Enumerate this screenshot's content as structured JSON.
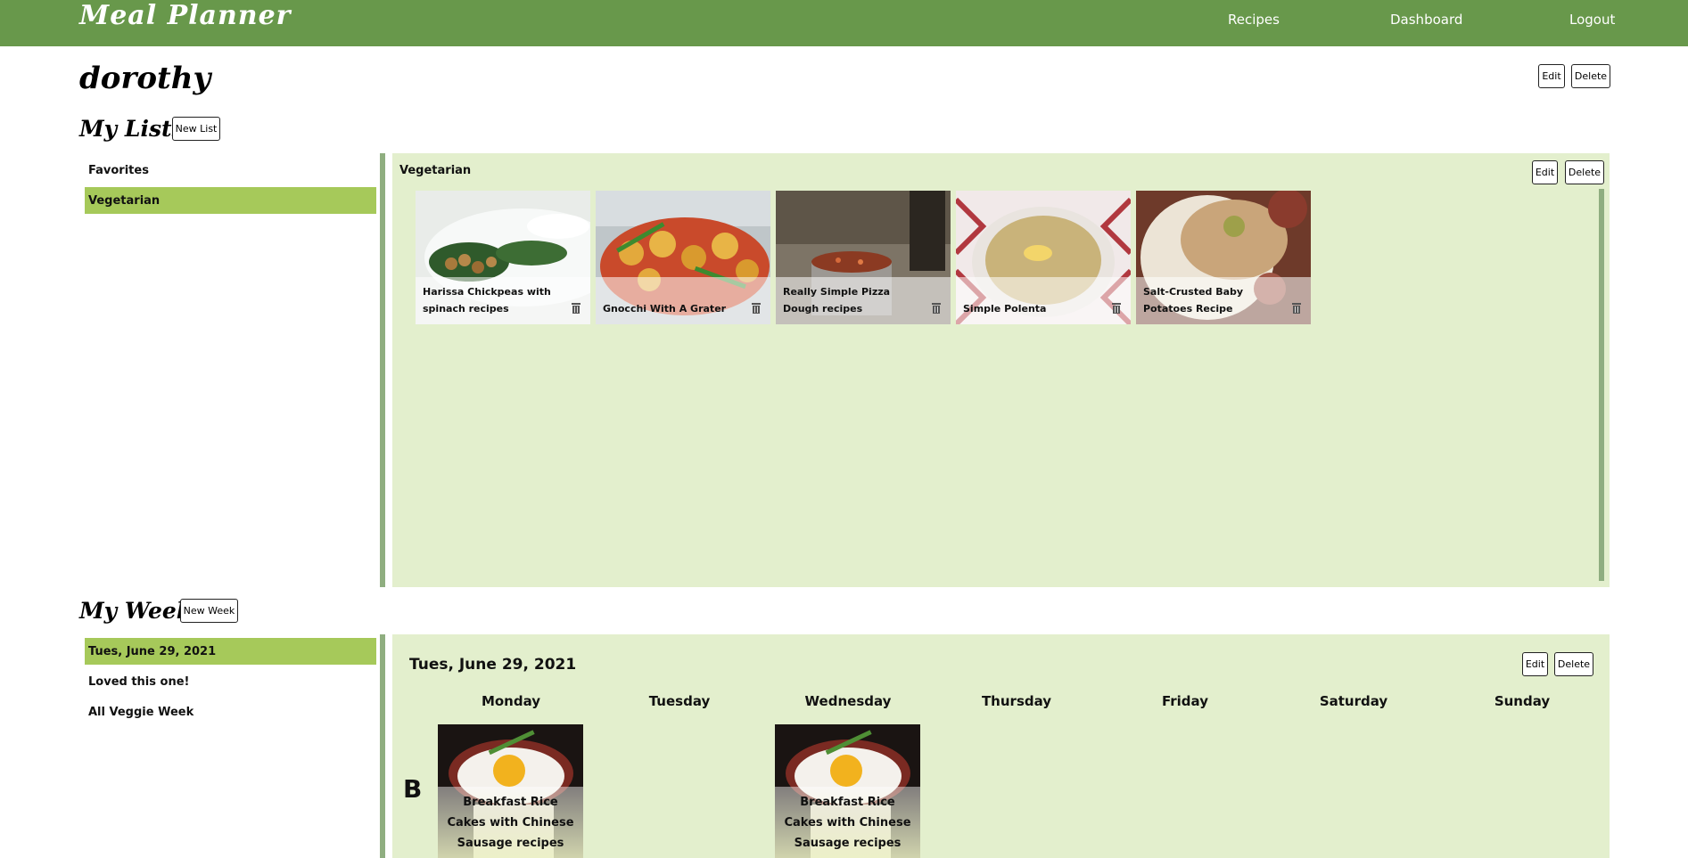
{
  "header": {
    "brand": "Meal Planner",
    "nav": [
      "Recipes",
      "Dashboard",
      "Logout"
    ]
  },
  "user": {
    "name": "dorothy",
    "edit_label": "Edit",
    "delete_label": "Delete"
  },
  "lists": {
    "title": "My Lists",
    "new_label": "New List",
    "items": [
      "Favorites",
      "Vegetarian"
    ],
    "active": "Vegetarian",
    "panel": {
      "title": "Vegetarian",
      "edit_label": "Edit",
      "delete_label": "Delete",
      "recipes": [
        {
          "title": "Harissa Chickpeas with spinach recipes",
          "icon": "trash-icon"
        },
        {
          "title": "Gnocchi With A Grater",
          "icon": "trash-icon"
        },
        {
          "title": "Really Simple Pizza Dough recipes",
          "icon": "trash-icon"
        },
        {
          "title": "Simple Polenta",
          "icon": "trash-icon"
        },
        {
          "title": "Salt-Crusted Baby Potatoes Recipe",
          "icon": "trash-icon"
        }
      ]
    }
  },
  "weeks": {
    "title": "My Weeks",
    "new_label": "New Week",
    "items": [
      "Tues, June 29, 2021",
      "Loved this one!",
      "All Veggie Week"
    ],
    "active": "Tues, June 29, 2021",
    "panel": {
      "title": "Tues, June 29, 2021",
      "edit_label": "Edit",
      "delete_label": "Delete",
      "days": [
        "Monday",
        "Tuesday",
        "Wednesday",
        "Thursday",
        "Friday",
        "Saturday",
        "Sunday"
      ],
      "meal_row_label": "B",
      "meals": [
        {
          "day": "Monday",
          "title": "Breakfast Rice Cakes with Chinese Sausage recipes"
        },
        {
          "day": "Wednesday",
          "title": "Breakfast Rice Cakes with Chinese Sausage recipes"
        }
      ]
    }
  },
  "colors": {
    "header": "#68984b",
    "active_item": "#a6c95a",
    "panel": "#e3efcd",
    "divider": "#8fae80"
  }
}
